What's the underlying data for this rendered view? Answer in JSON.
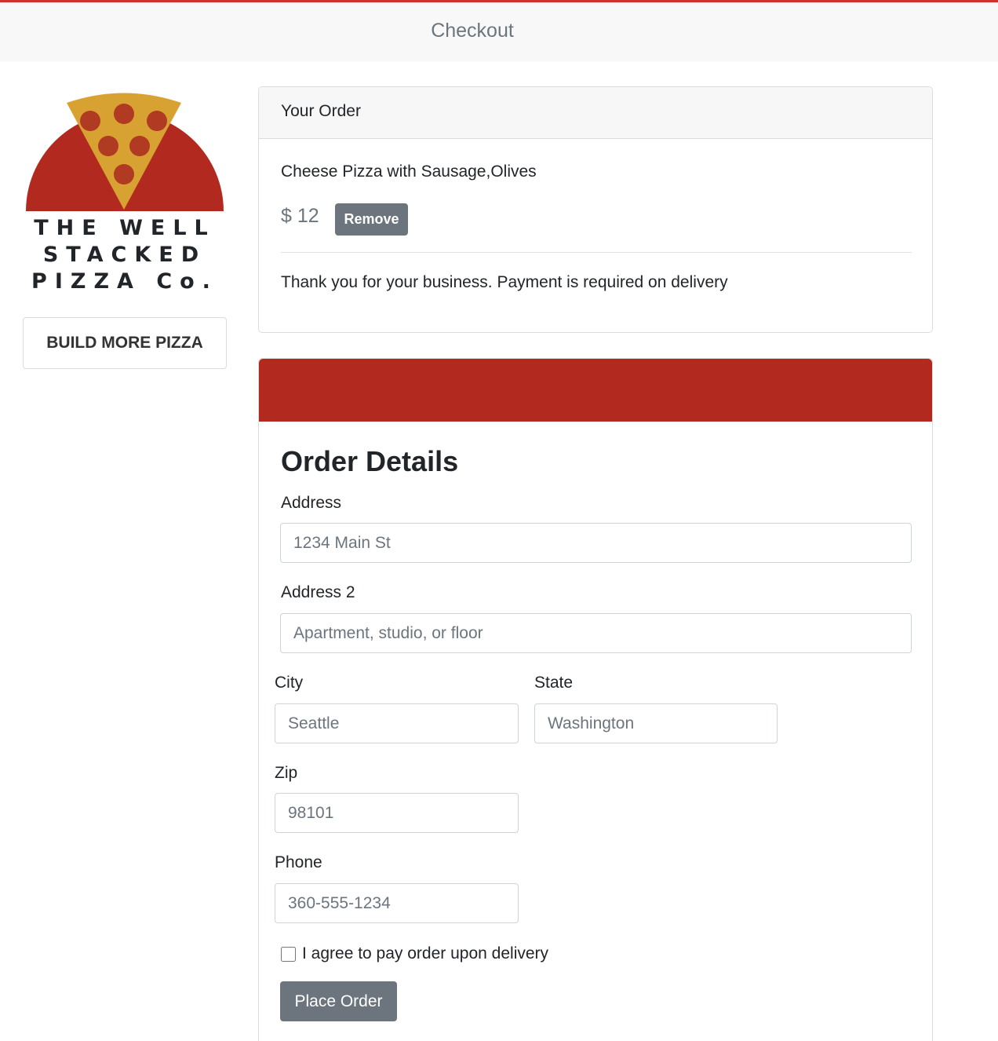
{
  "header": {
    "title": "Checkout"
  },
  "brand": {
    "line1": "THE WELL",
    "line2": "STACKED",
    "line3": "PIZZA Co."
  },
  "sidebar": {
    "build_button": "BUILD MORE PIZZA"
  },
  "order": {
    "heading": "Your Order",
    "item": "Cheese Pizza with Sausage,Olives",
    "price": "$ 12",
    "remove_label": "Remove",
    "note": "Thank you for your business. Payment is required on delivery"
  },
  "details": {
    "heading": "Order Details",
    "address_label": "Address",
    "address_placeholder": "1234 Main St",
    "address2_label": "Address 2",
    "address2_placeholder": "Apartment, studio, or floor",
    "city_label": "City",
    "city_placeholder": "Seattle",
    "state_label": "State",
    "state_placeholder": "Washington",
    "zip_label": "Zip",
    "zip_placeholder": "98101",
    "phone_label": "Phone",
    "phone_placeholder": "360-555-1234",
    "agree_label": "I agree to pay order upon delivery",
    "submit_label": "Place Order"
  },
  "colors": {
    "accent": "#b22a1f",
    "pizza_crust": "#d8a233",
    "pepperoni": "#b03a22",
    "button_gray": "#6c757d"
  }
}
